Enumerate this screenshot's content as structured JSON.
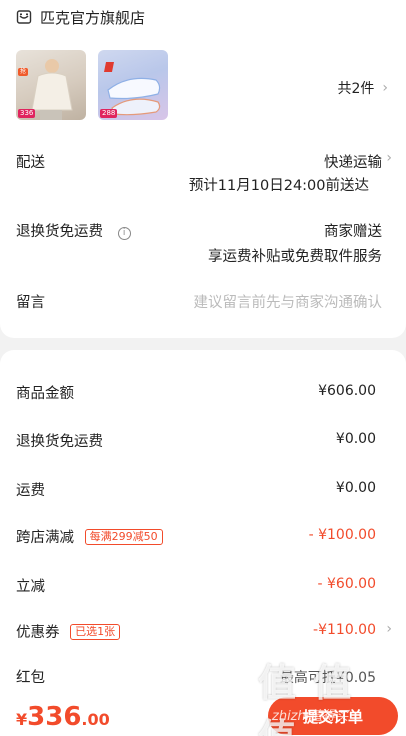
{
  "store": {
    "name": "匹克官方旗舰店"
  },
  "items": {
    "count_label": "共2件",
    "thumb1_tag": "336",
    "thumb1_badge": "抢",
    "thumb2_tag": "288"
  },
  "delivery": {
    "label": "配送",
    "method": "快递运输",
    "eta": "预计11月10日24:00前送达"
  },
  "return_insurance": {
    "label": "退换货免运费",
    "value": "商家赠送",
    "desc": "享运费补贴或免费取件服务"
  },
  "message": {
    "label": "留言",
    "placeholder": "建议留言前先与商家沟通确认"
  },
  "summary": {
    "goods_amount": {
      "label": "商品金额",
      "value": "¥606.00"
    },
    "return_free": {
      "label": "退换货免运费",
      "value": "¥0.00"
    },
    "shipping": {
      "label": "运费",
      "value": "¥0.00"
    },
    "cross_store": {
      "label": "跨店满减",
      "tag": "每满299减50",
      "value": "- ¥100.00"
    },
    "instant": {
      "label": "立减",
      "value": "- ¥60.00"
    },
    "coupon": {
      "label": "优惠券",
      "tag": "已选1张",
      "value": "-¥110.00"
    },
    "red_packet": {
      "label": "红包",
      "value": "最高可抵¥0.05"
    }
  },
  "footer": {
    "currency": "¥",
    "total_int": "336",
    "total_dec": ".00",
    "submit_label": "提交订单"
  },
  "watermark": {
    "text": "值 值 值",
    "sub": "zhizhi值得买"
  },
  "colors": {
    "accent": "#f24b2b",
    "background": "#f2f2f2"
  }
}
